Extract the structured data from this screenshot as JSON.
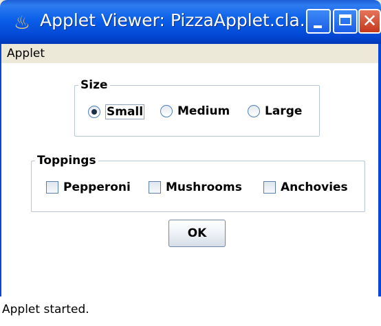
{
  "window": {
    "title": "Applet Viewer: PizzaApplet.cla...",
    "app_icon": "java-coffee-icon",
    "controls": [
      "minimize-icon",
      "maximize-icon",
      "close-icon"
    ]
  },
  "menubar": {
    "applet_menu": "Applet"
  },
  "size_group": {
    "legend": "Size",
    "options": [
      {
        "label": "Small",
        "selected": true
      },
      {
        "label": "Medium",
        "selected": false
      },
      {
        "label": "Large",
        "selected": false
      }
    ]
  },
  "toppings_group": {
    "legend": "Toppings",
    "options": [
      {
        "label": "Pepperoni",
        "checked": false
      },
      {
        "label": "Mushrooms",
        "checked": false
      },
      {
        "label": "Anchovies",
        "checked": false
      }
    ]
  },
  "ok_button": {
    "label": "OK"
  },
  "status_bar": {
    "text": "Applet started."
  },
  "colors": {
    "titlebar": "#0a5fe8",
    "window_bg": "#ece9d8",
    "close_button": "#c5381c"
  }
}
